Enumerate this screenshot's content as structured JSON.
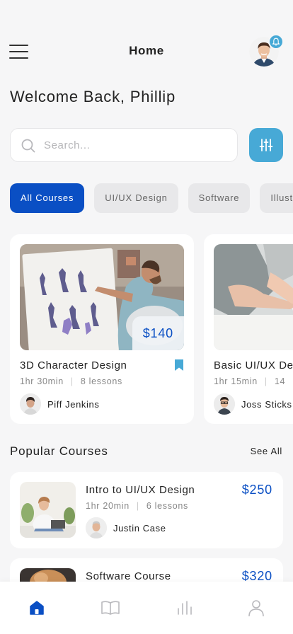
{
  "header": {
    "title": "Home",
    "notification_icon": "bell-icon"
  },
  "welcome": {
    "text": "Welcome Back, Phillip"
  },
  "search": {
    "placeholder": "Search...",
    "value": ""
  },
  "colors": {
    "primary": "#0a4fc4",
    "accent": "#47a9d6",
    "background": "#f6f6f7"
  },
  "categories": [
    {
      "label": "All Courses",
      "active": true
    },
    {
      "label": "UI/UX Design",
      "active": false
    },
    {
      "label": "Software",
      "active": false
    },
    {
      "label": "Illust",
      "active": false
    }
  ],
  "featured_courses": [
    {
      "title": "3D Character Design",
      "price": "$140",
      "duration": "1hr 30min",
      "lessons": "8 lessons",
      "author": "Piff Jenkins",
      "bookmarked": true
    },
    {
      "title": "Basic UI/UX De",
      "duration": "1hr 15min",
      "lessons": "14",
      "author": "Joss Sticks"
    }
  ],
  "popular": {
    "title": "Popular Courses",
    "see_all": "See All",
    "items": [
      {
        "title": "Intro to UI/UX Design",
        "price": "$250",
        "duration": "1hr 20min",
        "lessons": "6 lessons",
        "author": "Justin Case"
      },
      {
        "title": "Software Course",
        "price": "$320"
      }
    ]
  },
  "tabbar": {
    "items": [
      {
        "icon": "home-icon",
        "active": true
      },
      {
        "icon": "book-icon",
        "active": false
      },
      {
        "icon": "stats-icon",
        "active": false
      },
      {
        "icon": "profile-icon",
        "active": false
      }
    ]
  }
}
